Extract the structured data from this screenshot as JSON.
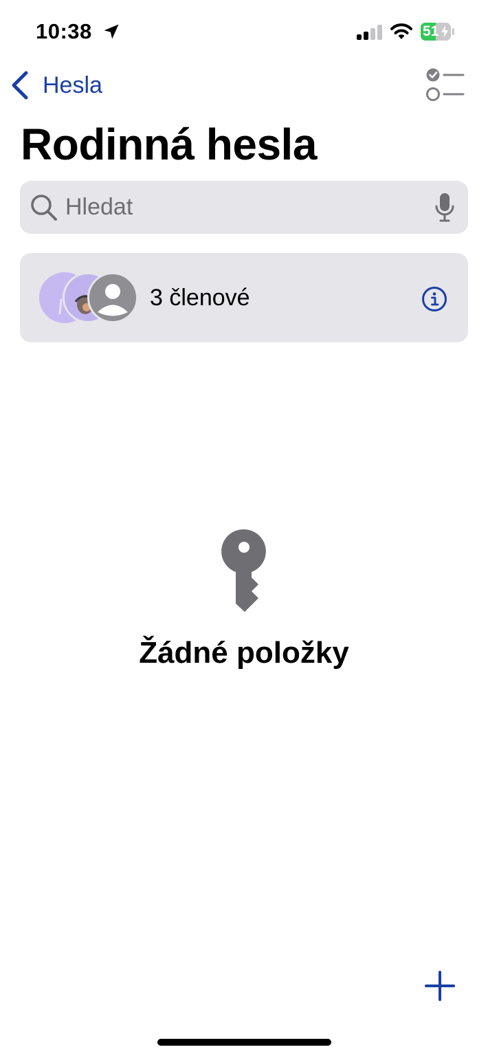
{
  "status_bar": {
    "time": "10:38",
    "battery_percent": "51",
    "battery_level": 0.51,
    "icons": [
      "location-arrow-icon",
      "cellular-signal-icon",
      "wifi-icon",
      "battery-charging-icon"
    ]
  },
  "nav": {
    "back_label": "Hesla",
    "back_icon": "chevron-left-icon",
    "select_icon": "checklist-icon"
  },
  "title": "Rodinná hesla",
  "search": {
    "placeholder": "Hledat",
    "value": "",
    "icons": [
      "search-icon",
      "microphone-icon"
    ]
  },
  "members": {
    "label": "3 členové",
    "count": 3,
    "icon": "info-icon"
  },
  "empty_state": {
    "icon": "key-icon",
    "label": "Žádné položky"
  },
  "toolbar": {
    "add_icon": "plus-icon"
  },
  "colors": {
    "accent": "#1a3fa6",
    "card_background": "#e5e5ea",
    "placeholder": "#6d6d72",
    "icon_gray": "#6e6e73",
    "battery_green": "#34c759"
  }
}
